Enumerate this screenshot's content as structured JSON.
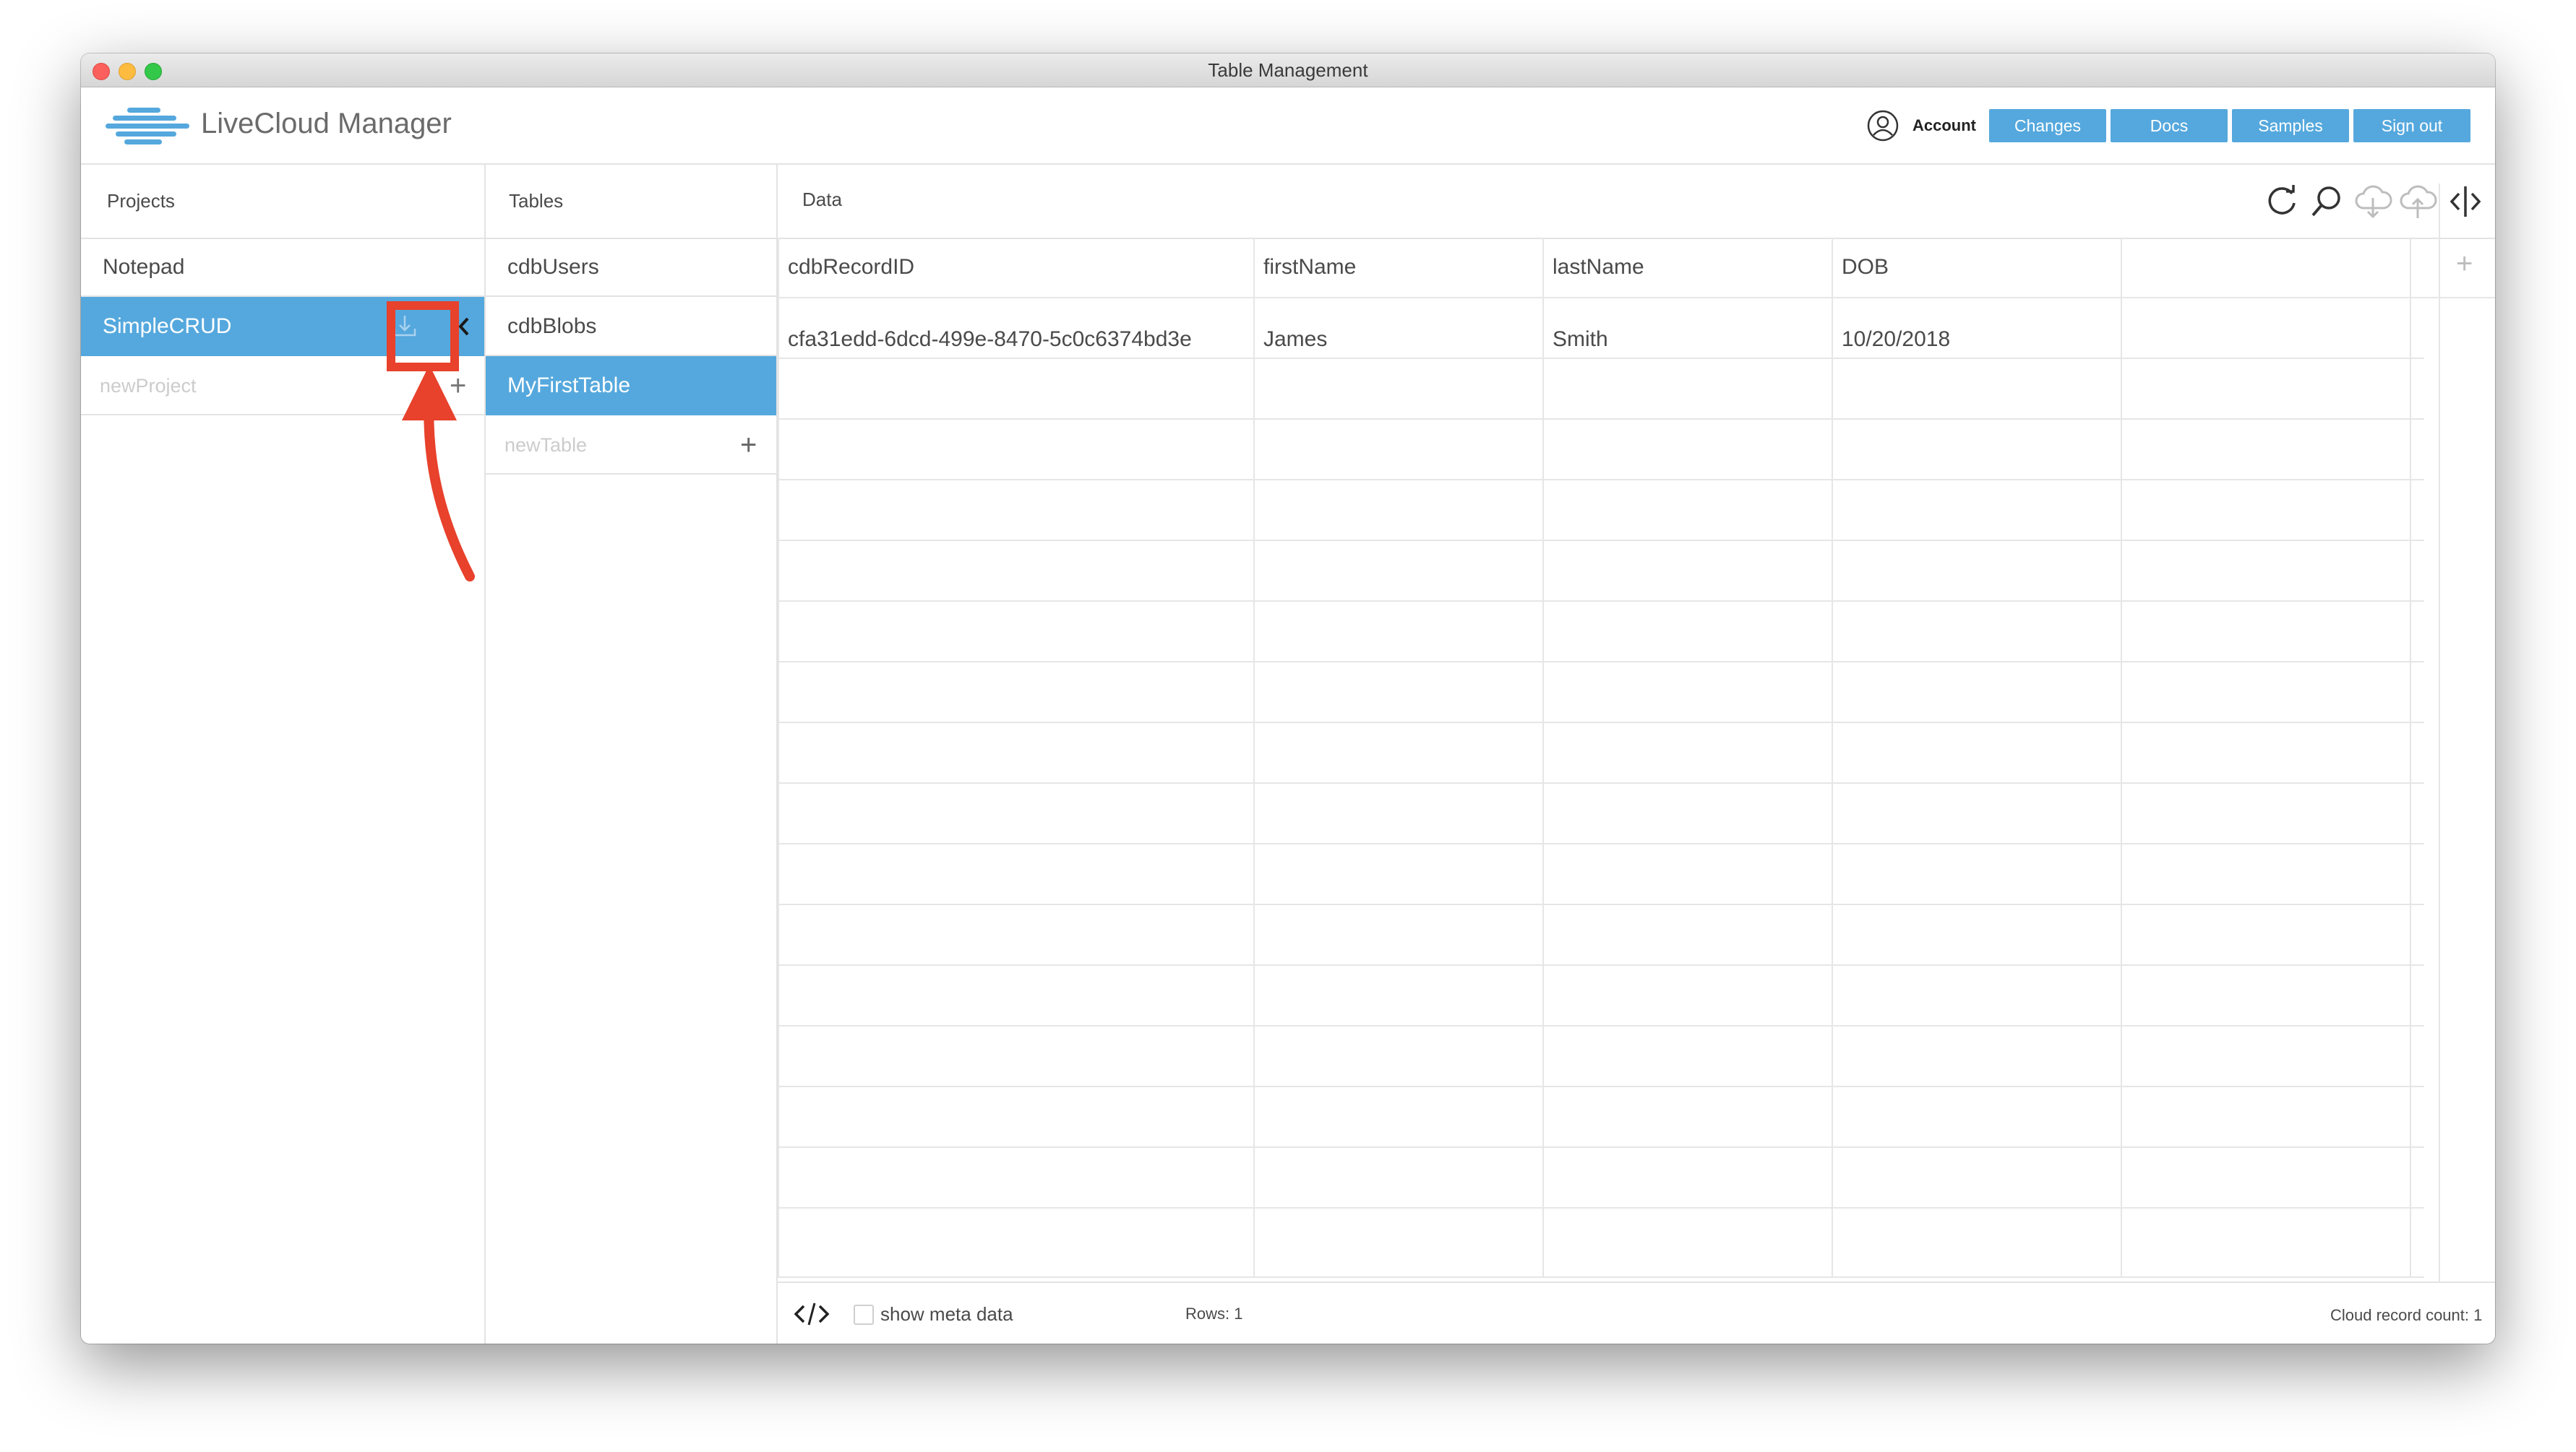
{
  "window": {
    "title": "Table Management"
  },
  "app": {
    "name": "LiveCloud Manager"
  },
  "header": {
    "account_label": "Account",
    "buttons": [
      "Changes",
      "Docs",
      "Samples",
      "Sign out"
    ]
  },
  "projects": {
    "heading": "Projects",
    "items": [
      "Notepad",
      "SimpleCRUD"
    ],
    "selected": "SimpleCRUD",
    "new_placeholder": "newProject"
  },
  "tables": {
    "heading": "Tables",
    "items": [
      "cdbUsers",
      "cdbBlobs",
      "MyFirstTable"
    ],
    "selected": "MyFirstTable",
    "new_placeholder": "newTable"
  },
  "data": {
    "heading": "Data",
    "columns": [
      "cdbRecordID",
      "firstName",
      "lastName",
      "DOB"
    ],
    "rows": [
      [
        "cfa31edd-6dcd-499e-8470-5c0c6374bd3e",
        "James",
        "Smith",
        "10/20/2018"
      ]
    ]
  },
  "footer": {
    "show_meta_label": "show meta data",
    "rows_label": "Rows: 1",
    "cloud_count_label": "Cloud record count: 1"
  },
  "icons": {
    "toolbar": [
      "refresh-icon",
      "search-icon",
      "cloud-download-icon",
      "cloud-upload-icon",
      "split-view-icon"
    ],
    "project_row": [
      "download-icon",
      "chevron-left-icon"
    ],
    "footer": [
      "code-icon"
    ]
  },
  "colors": {
    "accent": "#55a8dd",
    "annotation": "#e8412c"
  }
}
